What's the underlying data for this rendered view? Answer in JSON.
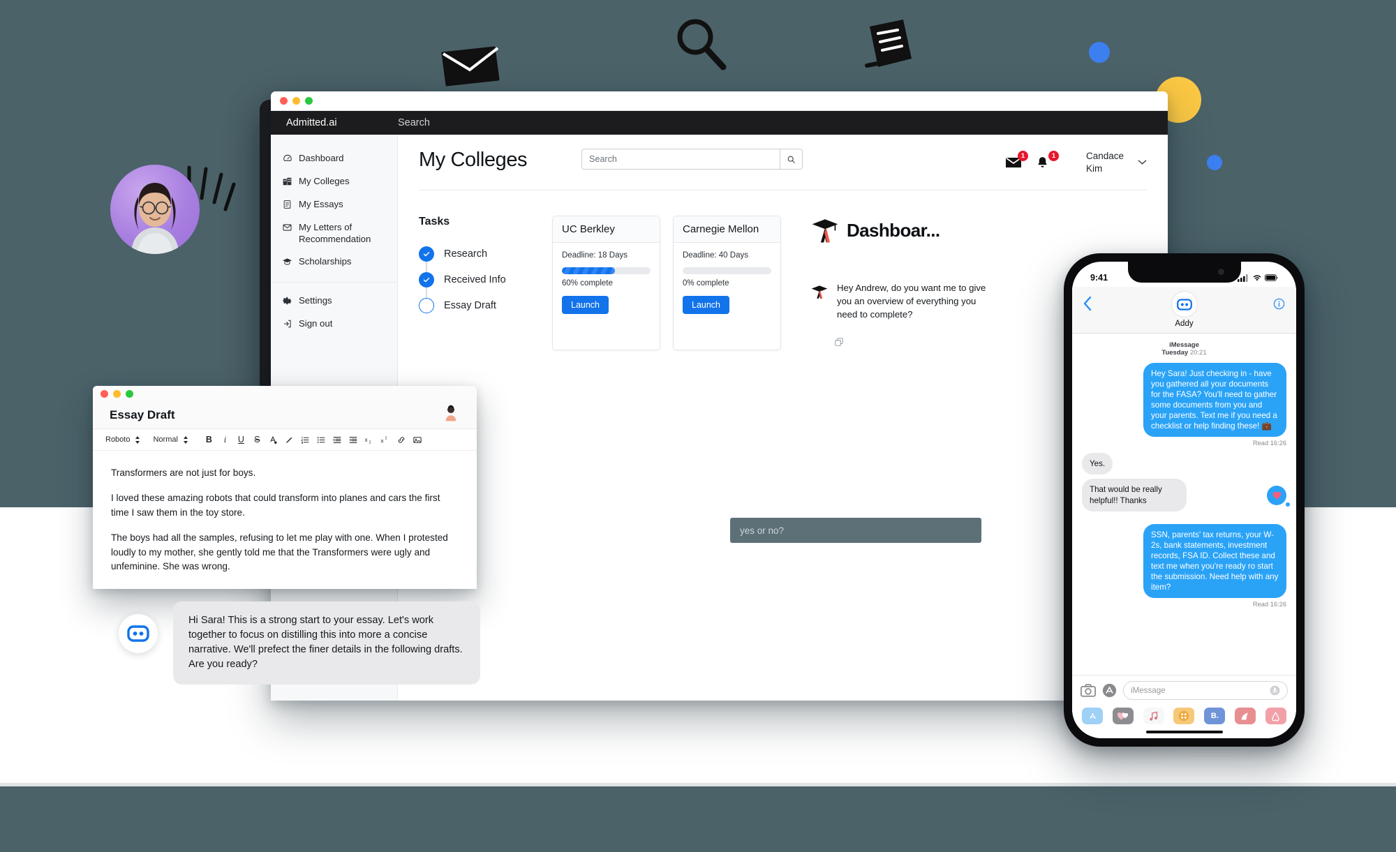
{
  "window": {
    "brand": "Admitted.ai",
    "topbar_search": "Search"
  },
  "sidebar": {
    "items": [
      {
        "label": "Dashboard",
        "icon": "dashboard-icon"
      },
      {
        "label": "My Colleges",
        "icon": "colleges-icon"
      },
      {
        "label": "My Essays",
        "icon": "essays-icon"
      },
      {
        "label": "My Letters of Recommendation",
        "icon": "letters-icon"
      },
      {
        "label": "Scholarships",
        "icon": "scholarships-icon"
      }
    ],
    "footer_items": [
      {
        "label": "Settings",
        "icon": "gear-icon"
      },
      {
        "label": "Sign out",
        "icon": "sign-out-icon"
      }
    ]
  },
  "header": {
    "page_title": "My Colleges",
    "search_placeholder": "Search",
    "search_value": "",
    "mail_badge": "1",
    "bell_badge": "1",
    "user_name": "Candace Kim"
  },
  "tasks": {
    "title": "Tasks",
    "items": [
      {
        "label": "Research",
        "done": true
      },
      {
        "label": "Received Info",
        "done": true
      },
      {
        "label": "Essay Draft",
        "done": false
      }
    ]
  },
  "colleges": [
    {
      "name": "UC Berkley",
      "deadline": "Deadline: 18 Days",
      "percent": 60,
      "percent_label": "60% complete",
      "button": "Launch"
    },
    {
      "name": "Carnegie Mellon",
      "deadline": "Deadline: 40 Days",
      "percent": 0,
      "percent_label": "0% complete",
      "button": "Launch"
    }
  ],
  "dashboard_panel": {
    "title": "Dashboar...",
    "message": "Hey Andrew, do you want me to give you an overview of everything you need to complete?"
  },
  "yesno_field": {
    "placeholder": "yes or no?"
  },
  "essay_window": {
    "title": "Essay Draft",
    "font": "Roboto",
    "style": "Normal",
    "tools": [
      "B",
      "i",
      "U",
      "S",
      "text-color-icon",
      "highlight-icon",
      "ordered-list-icon",
      "bullet-list-icon",
      "outdent-icon",
      "indent-icon",
      "subscript-icon",
      "superscript-icon",
      "link-icon",
      "image-icon"
    ],
    "paragraphs": [
      "Transformers are not just for boys.",
      "I loved these amazing robots that could transform into planes and cars the first time I saw them in the toy store.",
      "The boys had all the samples, refusing to let me play with one. When I protested loudly to my mother, she gently told me that the Transformers were ugly and unfeminine. She was wrong."
    ]
  },
  "bot_chat": {
    "message": "Hi Sara! This is a strong start to your essay. Let's work together to focus on distilling this into more a concise narrative. We'll prefect the finer details in the following drafts. Are you ready?"
  },
  "phone": {
    "status_time": "9:41",
    "contact_name": "Addy",
    "service": "iMessage",
    "thread_date": "Tuesday",
    "thread_time": "20:21",
    "messages": [
      {
        "dir": "out",
        "text": "Hey Sara! Just checking in - have you gathered all your documents for the FASA? You'll need to gather some documents from you and your parents. Text me if you need a checklist or help finding these! 💼",
        "receipt": "Read 16:26"
      },
      {
        "dir": "in",
        "text": "Yes."
      },
      {
        "dir": "in",
        "text": "That would be really helpful!! Thanks",
        "reaction": "heart"
      },
      {
        "dir": "out",
        "text": "SSN, parents' tax returns, your W-2s, bank statements, investment records, FSA ID. Collect these and text me when you're ready ro start the submission. Need help with any item?",
        "receipt": "Read 16:26"
      }
    ],
    "input_placeholder": "iMessage",
    "drawer_apps": [
      "app-store-icon",
      "hearts-icon",
      "music-icon",
      "dots-icon",
      "b-icon",
      "dog-icon",
      "airbnb-icon"
    ]
  },
  "colors": {
    "accent": "#1273ea",
    "imessage_blue": "#2aa3f7",
    "badge_red": "#e8172c",
    "logo_red": "#f1584a",
    "page_bg": "#4b6269",
    "doodle_blue": "#3b7ff0",
    "doodle_yellow": "#fbc844",
    "avatar_purple": "#a87fe0"
  }
}
